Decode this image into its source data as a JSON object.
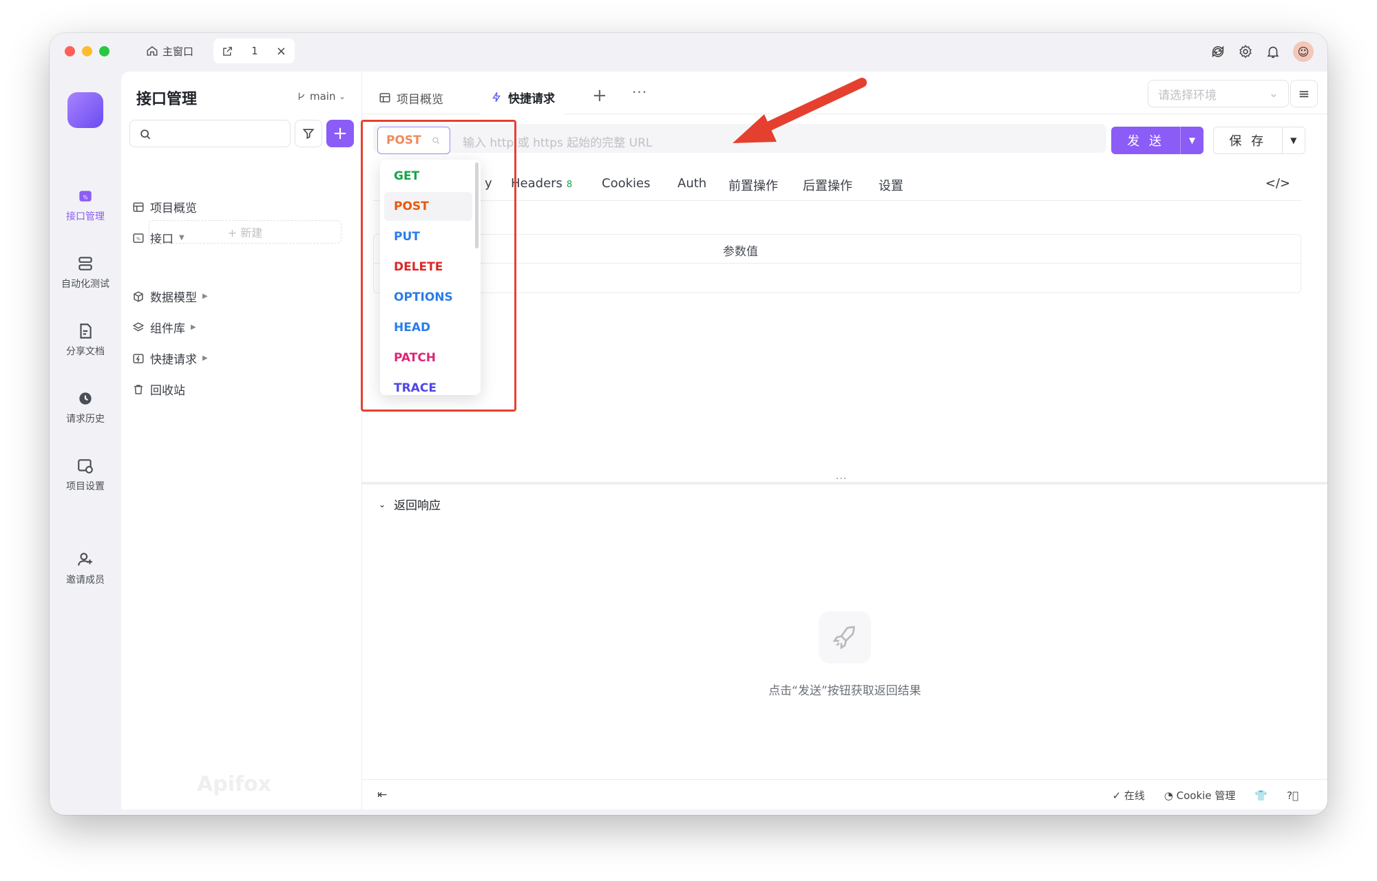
{
  "window": {
    "tabs": [
      {
        "label": "主窗口"
      },
      {
        "label": "1"
      }
    ]
  },
  "leftnav": {
    "items": [
      {
        "label": "接口管理",
        "icon": "api-icon"
      },
      {
        "label": "自动化测试",
        "icon": "automation-icon"
      },
      {
        "label": "分享文档",
        "icon": "share-doc-icon"
      },
      {
        "label": "请求历史",
        "icon": "history-icon"
      },
      {
        "label": "项目设置",
        "icon": "project-settings-icon"
      },
      {
        "label": "邀请成员",
        "icon": "invite-user-icon"
      }
    ]
  },
  "sidebar": {
    "title": "接口管理",
    "branch": "main",
    "search_placeholder": "",
    "tree": [
      {
        "label": "项目概览"
      },
      {
        "label": "接口"
      },
      {
        "label": "数据模型"
      },
      {
        "label": "组件库"
      },
      {
        "label": "快捷请求"
      },
      {
        "label": "回收站"
      }
    ],
    "new_label": "+ 新建",
    "watermark": "Apifox"
  },
  "tabs": [
    {
      "label": "项目概览"
    },
    {
      "label": "快捷请求"
    }
  ],
  "env": {
    "placeholder": "请选择环境"
  },
  "request": {
    "method": "POST",
    "url_placeholder": "输入 http 或 https 起始的完整 URL",
    "send_label": "发 送",
    "save_label": "保 存"
  },
  "subtabs": [
    {
      "label": "y"
    },
    {
      "label": "Headers",
      "badge": "8"
    },
    {
      "label": "Cookies"
    },
    {
      "label": "Auth"
    },
    {
      "label": "前置操作"
    },
    {
      "label": "后置操作"
    },
    {
      "label": "设置"
    }
  ],
  "params": {
    "value_header": "参数值"
  },
  "response": {
    "title": "返回响应",
    "empty_text": "点击“发送”按钮获取返回结果"
  },
  "statusbar": {
    "online": "在线",
    "cookie": "Cookie 管理"
  },
  "methods": [
    {
      "label": "GET",
      "color": "#16a34a"
    },
    {
      "label": "POST",
      "color": "#ea580c"
    },
    {
      "label": "PUT",
      "color": "#2b7de9"
    },
    {
      "label": "DELETE",
      "color": "#dc2626"
    },
    {
      "label": "OPTIONS",
      "color": "#2b7de9"
    },
    {
      "label": "HEAD",
      "color": "#2b7de9"
    },
    {
      "label": "PATCH",
      "color": "#db2777"
    },
    {
      "label": "TRACE",
      "color": "#4f46e5"
    }
  ],
  "colors": {
    "accent": "#8b5cf6",
    "annotation": "#e5402f"
  }
}
